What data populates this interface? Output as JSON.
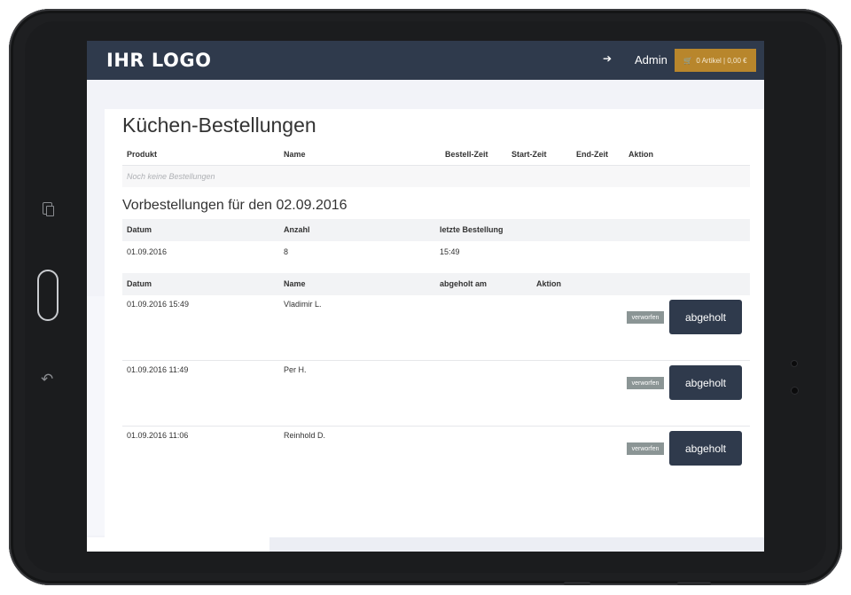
{
  "header": {
    "logo": "IHR LOGO",
    "user_label": "Admin",
    "cart_label": "0 Artikel | 0,00 €",
    "logout_icon": "logout-icon",
    "cart_icon": "cart-icon"
  },
  "kitchen": {
    "title": "Küchen-Bestellungen",
    "columns": [
      "Produkt",
      "Name",
      "Bestell-Zeit",
      "Start-Zeit",
      "End-Zeit",
      "Aktion"
    ],
    "empty_text": "Noch keine Bestellungen"
  },
  "preorders": {
    "title": "Vorbestellungen für den 02.09.2016",
    "summary_columns": [
      "Datum",
      "Anzahl",
      "letzte Bestellung"
    ],
    "summary_row": {
      "datum": "01.09.2016",
      "anzahl": "8",
      "letzte": "15:49"
    },
    "order_columns": [
      "Datum",
      "Name",
      "abgeholt am",
      "Aktion"
    ],
    "orders": [
      {
        "datum": "01.09.2016 15:49",
        "name": "Vladimir L."
      },
      {
        "datum": "01.09.2016 11:49",
        "name": "Per H."
      },
      {
        "datum": "01.09.2016 11:06",
        "name": "Reinhold D."
      }
    ],
    "discard_label": "verworfen",
    "pickup_label": "abgeholt"
  },
  "colors": {
    "header_bg": "#2f3a4c",
    "cart_accent": "#b8862c",
    "discard_bg": "#8b9595",
    "pickup_bg": "#2f3a4c"
  }
}
